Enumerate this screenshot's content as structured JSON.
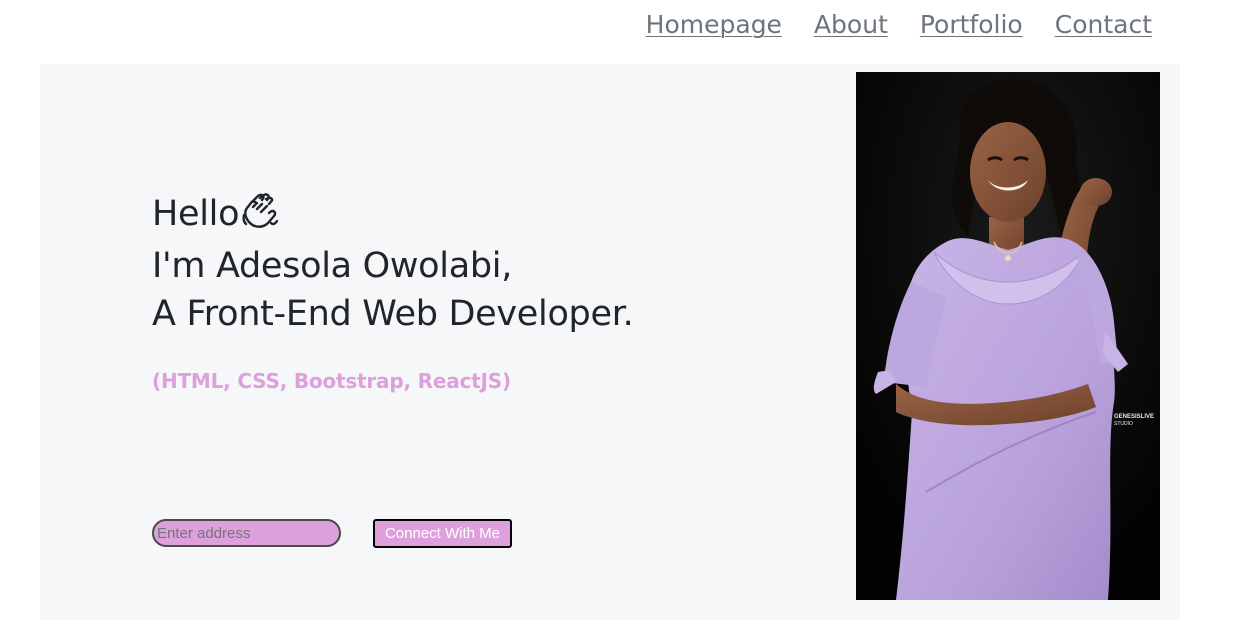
{
  "nav": {
    "items": [
      {
        "label": "Homepage"
      },
      {
        "label": "About"
      },
      {
        "label": "Portfolio"
      },
      {
        "label": "Contact"
      }
    ]
  },
  "hero": {
    "greeting": "Hello",
    "greeting_icon": "waving-hand-icon",
    "intro": "I'm Adesola Owolabi,",
    "role": "A Front-End Web Developer.",
    "skills": "(HTML, CSS, Bootstrap, ReactJS)",
    "skills_color": "#dda0dd"
  },
  "contact_form": {
    "address_placeholder": "Enter address",
    "address_value": "",
    "button_label": "Connect With Me",
    "accent_color": "#dda0dd"
  },
  "photo": {
    "watermark_line1": "GENESISLIVE",
    "watermark_line2": "STUDIO"
  }
}
